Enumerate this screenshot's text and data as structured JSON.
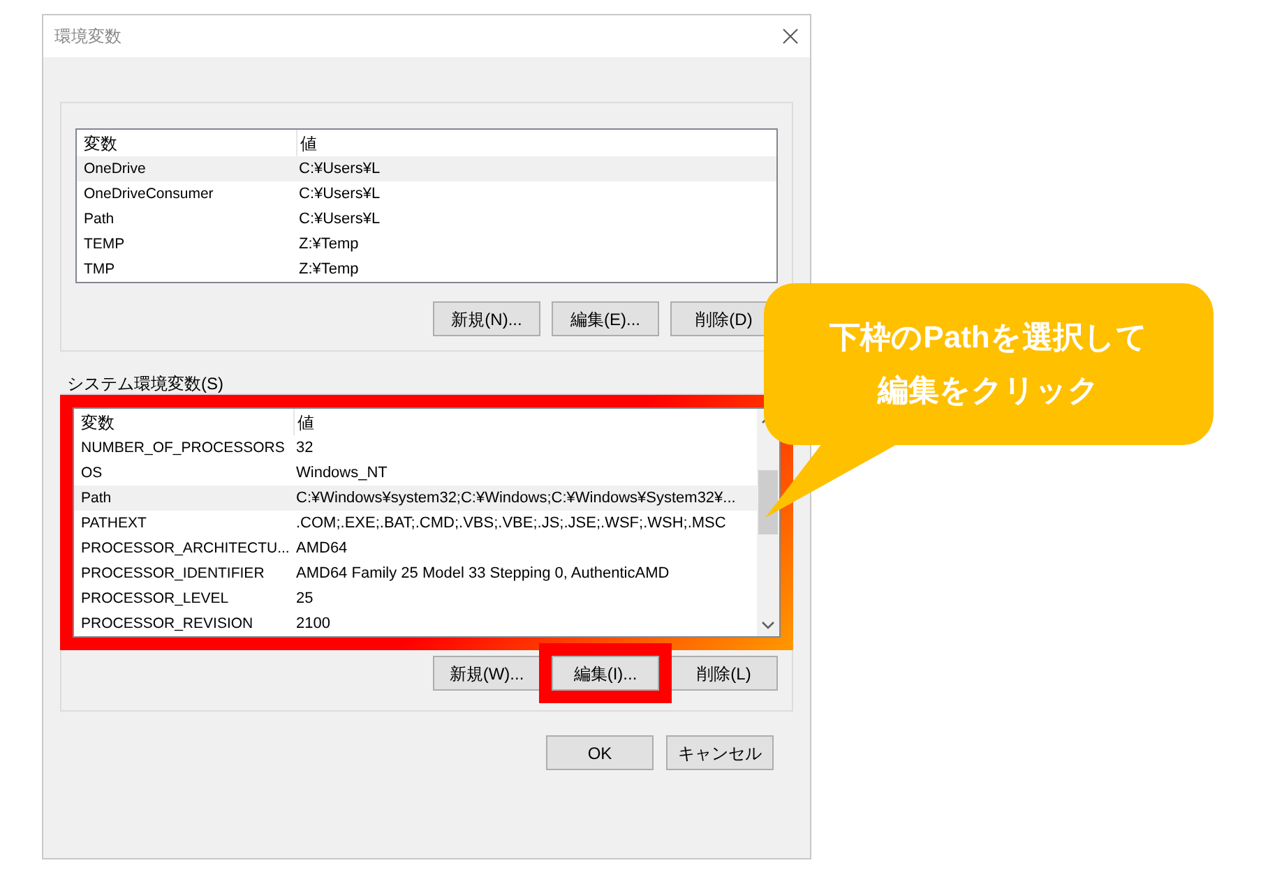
{
  "window": {
    "title": "環境変数"
  },
  "user_variables": {
    "columns": [
      "変数",
      "値"
    ],
    "rows": [
      {
        "name": "OneDrive",
        "value": "C:¥Users¥L",
        "selected": true
      },
      {
        "name": "OneDriveConsumer",
        "value": "C:¥Users¥L",
        "selected": false
      },
      {
        "name": "Path",
        "value": "C:¥Users¥L",
        "selected": false
      },
      {
        "name": "TEMP",
        "value": "Z:¥Temp",
        "selected": false
      },
      {
        "name": "TMP",
        "value": "Z:¥Temp",
        "selected": false
      }
    ],
    "buttons": [
      {
        "label": "新規(N)...",
        "highlighted": false
      },
      {
        "label": "編集(E)...",
        "highlighted": false
      },
      {
        "label": "削除(D)",
        "highlighted": false
      }
    ]
  },
  "system_variables": {
    "title": "システム環境変数(S)",
    "highlighted": true,
    "columns": [
      "変数",
      "値"
    ],
    "rows": [
      {
        "name": "NUMBER_OF_PROCESSORS",
        "value": "32",
        "selected": false
      },
      {
        "name": "OS",
        "value": "Windows_NT",
        "selected": false
      },
      {
        "name": "Path",
        "value": "C:¥Windows¥system32;C:¥Windows;C:¥Windows¥System32¥...",
        "selected": true
      },
      {
        "name": "PATHEXT",
        "value": ".COM;.EXE;.BAT;.CMD;.VBS;.VBE;.JS;.JSE;.WSF;.WSH;.MSC",
        "selected": false
      },
      {
        "name": "PROCESSOR_ARCHITECTU...",
        "value": "AMD64",
        "selected": false
      },
      {
        "name": "PROCESSOR_IDENTIFIER",
        "value": "AMD64 Family 25 Model 33 Stepping 0, AuthenticAMD",
        "selected": false
      },
      {
        "name": "PROCESSOR_LEVEL",
        "value": "25",
        "selected": false
      },
      {
        "name": "PROCESSOR_REVISION",
        "value": "2100",
        "selected": false
      }
    ],
    "buttons": [
      {
        "label": "新規(W)...",
        "highlighted": false
      },
      {
        "label": "編集(I)...",
        "highlighted": true
      },
      {
        "label": "削除(L)",
        "highlighted": false
      }
    ]
  },
  "footer_buttons": [
    "OK",
    "キャンセル"
  ],
  "callout": {
    "lines": [
      "下枠のPathを選択して",
      "編集をクリック"
    ]
  }
}
